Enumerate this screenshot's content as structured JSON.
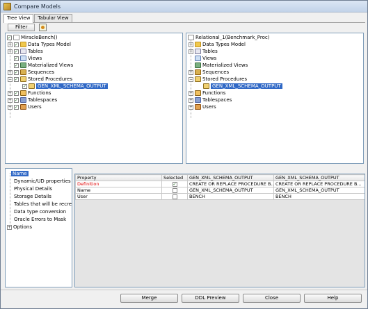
{
  "window": {
    "title": "Compare Models"
  },
  "tabs": [
    {
      "label": "Tree View"
    },
    {
      "label": "Tabular View"
    }
  ],
  "toolbar": {
    "filter_label": "Filter"
  },
  "left_tree": {
    "root": "MiracleBench()",
    "items": [
      {
        "label": "Data Types Model"
      },
      {
        "label": "Tables"
      },
      {
        "label": "Views"
      },
      {
        "label": "Materialized Views"
      },
      {
        "label": "Sequences"
      },
      {
        "label": "Stored Procedures"
      },
      {
        "label": "GEN_XML_SCHEMA_OUTPUT"
      },
      {
        "label": "Functions"
      },
      {
        "label": "Tablespaces"
      },
      {
        "label": "Users"
      }
    ]
  },
  "right_tree": {
    "root": "Relational_1(Benchmark_Proc)",
    "items": [
      {
        "label": "Data Types Model"
      },
      {
        "label": "Tables"
      },
      {
        "label": "Views"
      },
      {
        "label": "Materialized Views"
      },
      {
        "label": "Sequences"
      },
      {
        "label": "Stored Procedures"
      },
      {
        "label": "GEN_XML_SCHEMA_OUTPUT"
      },
      {
        "label": "Functions"
      },
      {
        "label": "Tablespaces"
      },
      {
        "label": "Users"
      }
    ]
  },
  "options": [
    {
      "label": "Name"
    },
    {
      "label": "Dynamic/UD properties"
    },
    {
      "label": "Physical Details"
    },
    {
      "label": "Storage Details"
    },
    {
      "label": "Tables that will be recreated"
    },
    {
      "label": "Data type conversion"
    },
    {
      "label": "Oracle Errors to Mask"
    },
    {
      "label": "Options"
    }
  ],
  "grid": {
    "headers": [
      "Property",
      "Selected",
      "GEN_XML_SCHEMA_OUTPUT",
      "GEN_XML_SCHEMA_OUTPUT"
    ],
    "rows": [
      {
        "property": "Definition",
        "left": "CREATE OR REPLACE PROCEDURE B...",
        "right": "CREATE OR REPLACE PROCEDURE B..."
      },
      {
        "property": "Name",
        "left": "GEN_XML_SCHEMA_OUTPUT",
        "right": "GEN_XML_SCHEMA_OUTPUT"
      },
      {
        "property": "User",
        "left": "BENCH",
        "right": "BENCH"
      }
    ]
  },
  "buttons": {
    "merge": "Merge",
    "ddl_preview": "DDL Preview",
    "close": "Close",
    "help": "Help"
  }
}
